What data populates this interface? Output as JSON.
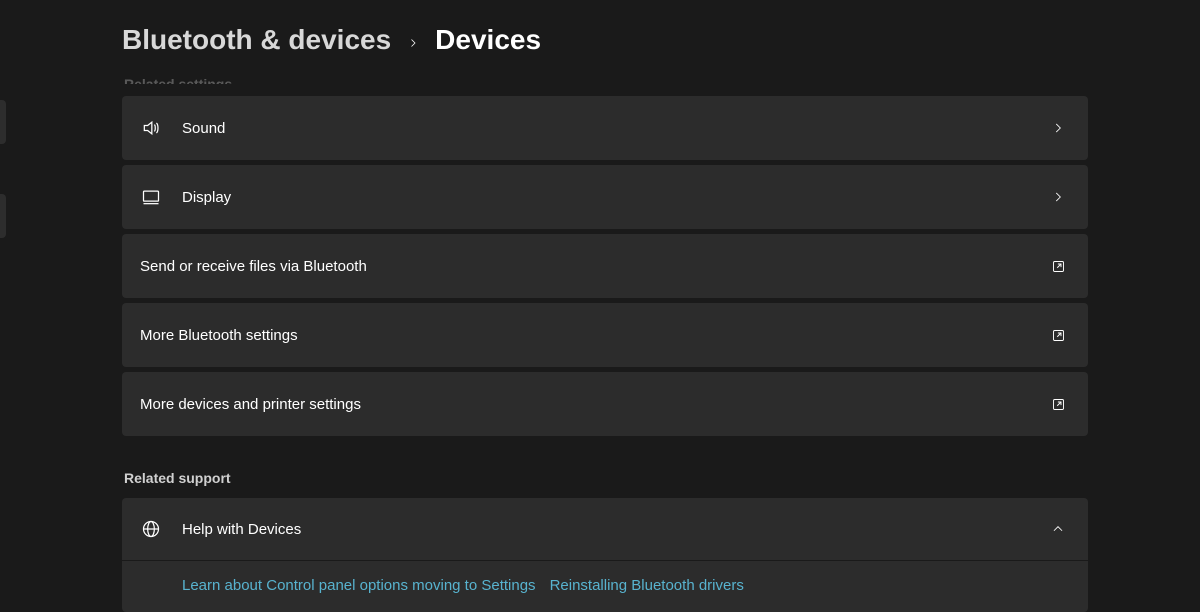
{
  "breadcrumb": {
    "parent": "Bluetooth & devices",
    "current": "Devices"
  },
  "sections": {
    "related_settings_heading": "Related settings",
    "related_support_heading": "Related support"
  },
  "items": {
    "sound": {
      "label": "Sound"
    },
    "display": {
      "label": "Display"
    },
    "bt_files": {
      "label": "Send or receive files via Bluetooth"
    },
    "more_bt": {
      "label": "More Bluetooth settings"
    },
    "more_devices": {
      "label": "More devices and printer settings"
    }
  },
  "support": {
    "title": "Help with Devices",
    "links": [
      "Learn about Control panel options moving to Settings",
      "Reinstalling Bluetooth drivers"
    ]
  }
}
